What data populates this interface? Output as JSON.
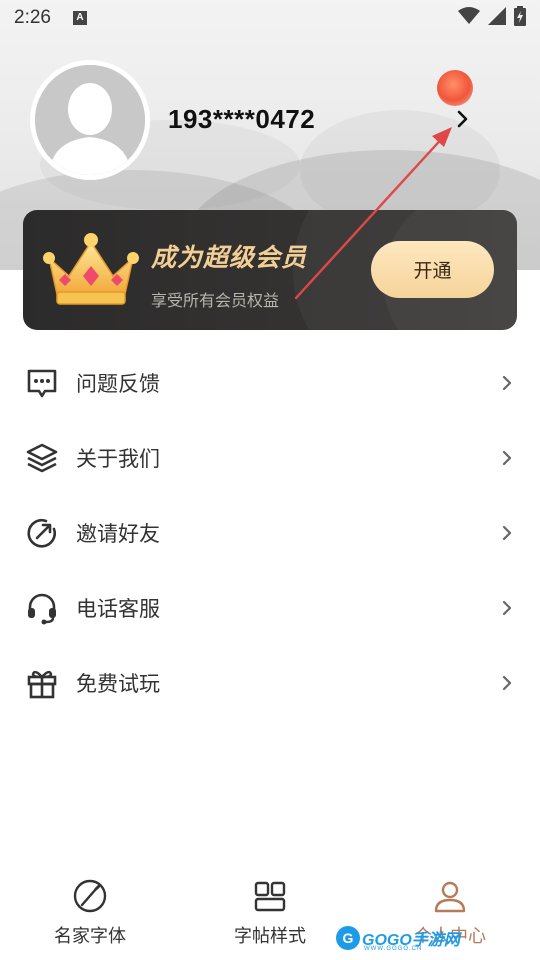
{
  "status_bar": {
    "time": "2:26",
    "notification_letter": "A"
  },
  "profile": {
    "phone": "193****0472"
  },
  "vip": {
    "title": "成为超级会员",
    "subtitle": "享受所有会员权益",
    "button_label": "开通"
  },
  "menu": {
    "items": [
      {
        "label": "问题反馈",
        "icon": "feedback-icon"
      },
      {
        "label": "关于我们",
        "icon": "layers-icon"
      },
      {
        "label": "邀请好友",
        "icon": "invite-icon"
      },
      {
        "label": "电话客服",
        "icon": "headset-icon"
      },
      {
        "label": "免费试玩",
        "icon": "gift-icon"
      }
    ]
  },
  "bottom_nav": {
    "tabs": [
      {
        "label": "名家字体",
        "icon": "pen-nib-icon",
        "active": false
      },
      {
        "label": "字帖样式",
        "icon": "grid-icon",
        "active": false
      },
      {
        "label": "个人中心",
        "icon": "person-icon",
        "active": true
      }
    ]
  },
  "watermark": {
    "logo_letter": "G",
    "text": "GOGO手游网",
    "url": "WWW.GOGO.CN"
  },
  "colors": {
    "accent_gold": "#f2cf94",
    "vip_button": "#f6d49b",
    "active_tab": "#b57a57",
    "annotation_arrow": "#e04848"
  }
}
